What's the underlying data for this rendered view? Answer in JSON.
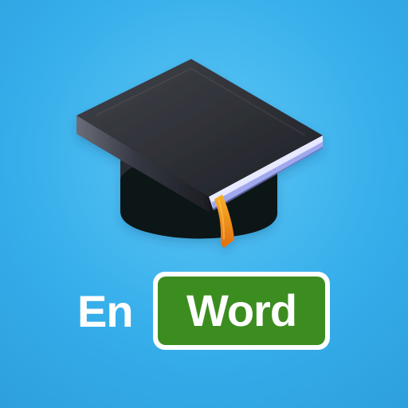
{
  "logo": {
    "icon": "graduation-cap-book-icon",
    "text_prefix": "En",
    "text_badge": "Word"
  },
  "colors": {
    "background": "#35aeea",
    "badge_background": "#3c8d20",
    "badge_border": "#ffffff",
    "cap": "#2f3033",
    "pages": "#d7dbff",
    "tassel": "#f28a17"
  }
}
